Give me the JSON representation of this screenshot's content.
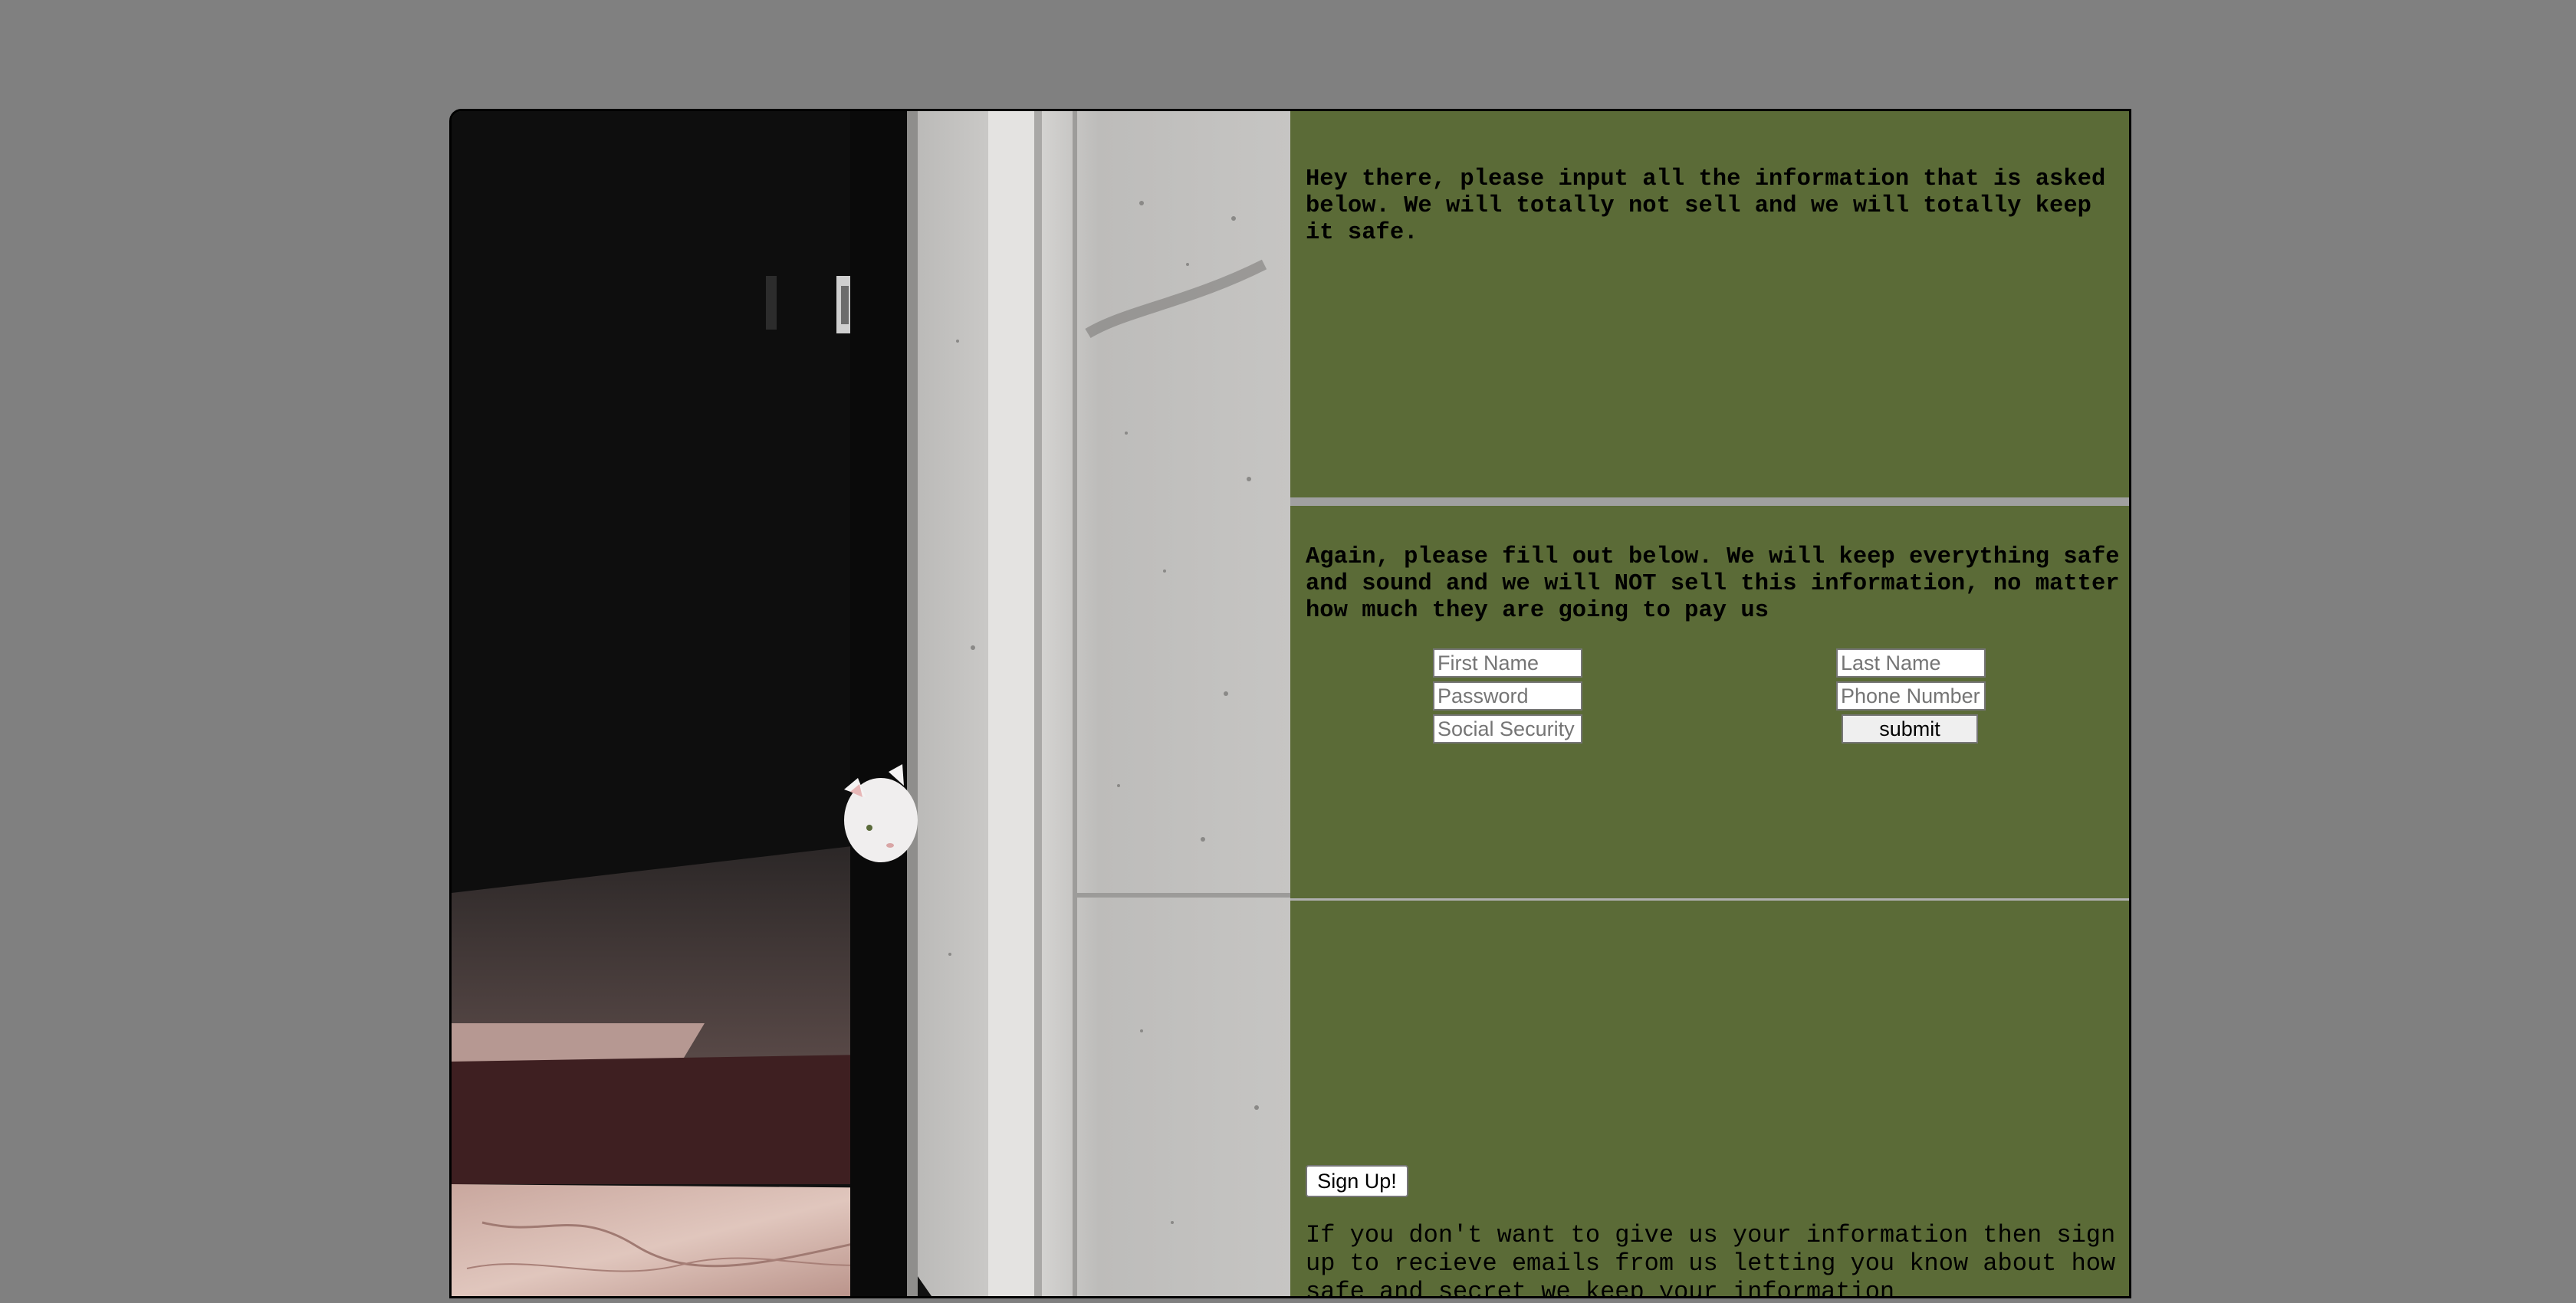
{
  "section1": {
    "message": "Hey there, please input all the information that is asked below. We will totally not sell and we will totally keep it safe."
  },
  "section2": {
    "message": "Again, please fill out below. We will keep everything safe and sound and we will NOT sell this information, no matter how much they are going to pay us",
    "form": {
      "first_name_placeholder": "First Name",
      "last_name_placeholder": "Last Name",
      "password_placeholder": "Password",
      "phone_placeholder": "Phone Number",
      "ssn_placeholder": "Social Security",
      "submit_label": "submit"
    }
  },
  "section3": {
    "signup_label": "Sign Up!",
    "message": "If you don't want to give us your information then sign up to recieve emails from us letting you know about how safe and secret we keep your information"
  },
  "colors": {
    "page_background": "#808080",
    "panel_green": "#5b6b37",
    "separator": "#a0a0a0"
  },
  "image": {
    "icon": "cat-peeking-photo"
  }
}
